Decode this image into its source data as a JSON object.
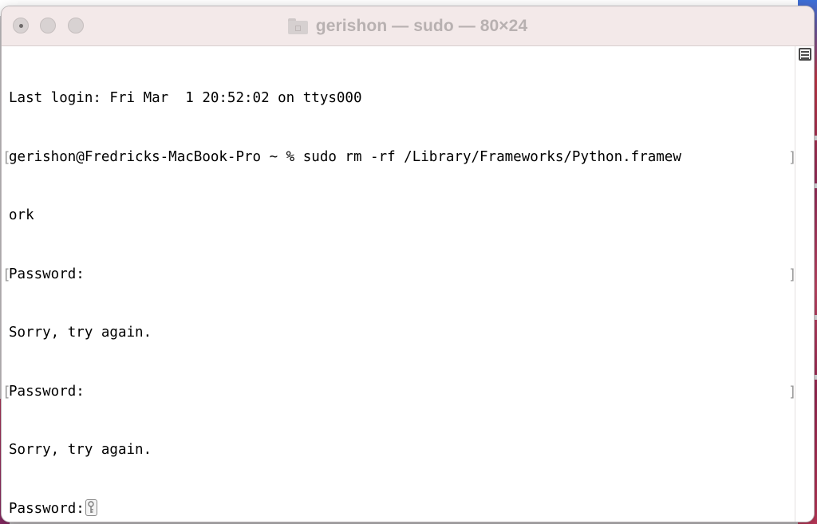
{
  "window": {
    "title": "gerishon — sudo — 80×24"
  },
  "terminal": {
    "lines": [
      {
        "text": "Last login: Fri Mar  1 20:52:02 on ttys000",
        "bracket": false
      },
      {
        "text": "gerishon@Fredricks-MacBook-Pro ~ % sudo rm -rf /Library/Frameworks/Python.framew",
        "bracket": true
      },
      {
        "text": "ork",
        "bracket": false
      },
      {
        "text": "Password:",
        "bracket": true
      },
      {
        "text": "Sorry, try again.",
        "bracket": false
      },
      {
        "text": "Password:",
        "bracket": true
      },
      {
        "text": "Sorry, try again.",
        "bracket": false
      },
      {
        "text": "Password:",
        "bracket": false
      }
    ],
    "cursor_icon": "key-icon"
  },
  "colors": {
    "titlebar_bg": "#f3e9e9",
    "title_text": "#b8b1b1",
    "terminal_text": "#000000",
    "bracket_mark": "#9a9a9a"
  }
}
